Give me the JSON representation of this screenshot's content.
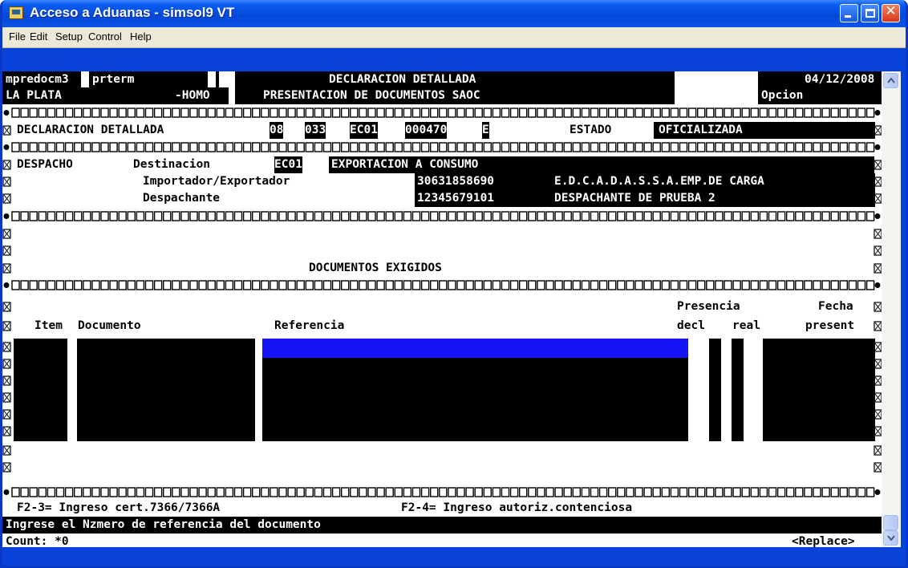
{
  "window": {
    "title": "Acceso a Aduanas - simsol9 VT",
    "accent": "#0842d8"
  },
  "menu": [
    "File",
    "Edit",
    "Setup",
    "Control",
    "Help"
  ],
  "terminal": {
    "top_left_1": "mpredocm3",
    "top_left_2": "prterm",
    "location": "LA PLATA",
    "env": "-HOMO",
    "title": "DECLARACION DETALLADA",
    "subtitle": "PRESENTACION DE DOCUMENTOS SAOC",
    "date": "04/12/2008",
    "option_label": "Opcion",
    "declaration_label": "DECLARACION DETALLADA",
    "decl_fields": [
      "08",
      "033",
      "EC01",
      "000470",
      "E"
    ],
    "status_label": "ESTADO",
    "status_value": "OFICIALIZADA",
    "despacho_label": "DESPACHO",
    "destinacion_label": "Destinacion",
    "destinacion_code": "EC01",
    "destinacion_desc": "EXPORTACION A CONSUMO",
    "importador_label": "Importador/Exportador",
    "importador_id": "30631858690",
    "importador_name": "E.D.C.A.D.A.S.S.A.EMP.DE CARGA",
    "despachante_label": "Despachante",
    "despachante_id": "12345679101",
    "despachante_name": "DESPACHANTE DE PRUEBA 2",
    "section_title": "DOCUMENTOS EXIGIDOS",
    "columns": {
      "item": "Item",
      "documento": "Documento",
      "referencia": "Referencia",
      "presencia": "Presencia",
      "decl": "decl",
      "real": "real",
      "fecha": "Fecha",
      "present": "present"
    },
    "fkey_1": "F2-3= Ingreso cert.7366/7366A",
    "fkey_2": "F2-4= Ingreso autoriz.contenciosa",
    "prompt": "Ingrese el Nzmero de referencia del documento",
    "count": "Count: *0",
    "mode": "<Replace>"
  }
}
